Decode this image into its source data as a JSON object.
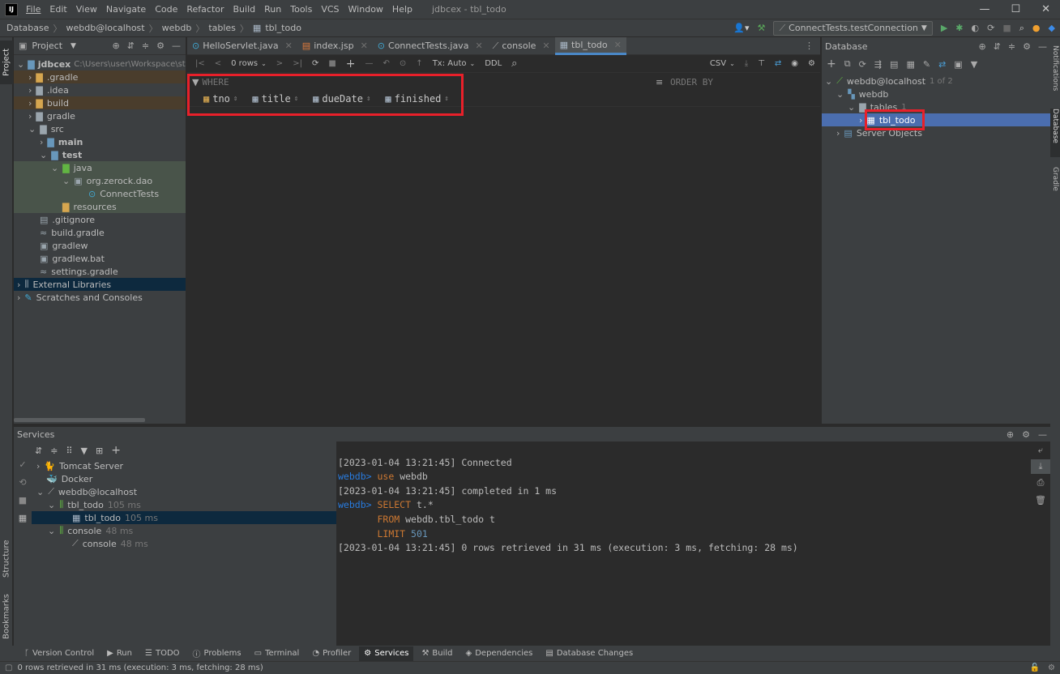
{
  "menu": {
    "items": [
      "File",
      "Edit",
      "View",
      "Navigate",
      "Code",
      "Refactor",
      "Build",
      "Run",
      "Tools",
      "VCS",
      "Window",
      "Help"
    ],
    "title": "jdbcex - tbl_todo"
  },
  "breadcrumb": [
    "Database",
    "webdb@localhost",
    "webdb",
    "tables",
    "tbl_todo"
  ],
  "run_config": "ConnectTests.testConnection",
  "project_panel": {
    "title": "Project",
    "root_name": "jdbcex",
    "root_path": "C:\\Users\\user\\Workspace\\stud",
    "items": [
      ".gradle",
      ".idea",
      "build",
      "gradle",
      "src",
      "main",
      "test",
      "java",
      "org.zerock.dao",
      "ConnectTests",
      "resources",
      ".gitignore",
      "build.gradle",
      "gradlew",
      "gradlew.bat",
      "settings.gradle",
      "External Libraries",
      "Scratches and Consoles"
    ]
  },
  "editor_tabs": [
    "HelloServlet.java",
    "index.jsp",
    "ConnectTests.java",
    "console",
    "tbl_todo"
  ],
  "grid_toolbar": {
    "rows": "0 rows",
    "tx": "Tx: Auto",
    "ddl": "DDL",
    "csv": "CSV"
  },
  "filter": {
    "where": "WHERE",
    "order_by": "ORDER BY"
  },
  "columns": [
    "tno",
    "title",
    "dueDate",
    "finished"
  ],
  "database_panel": {
    "title": "Database",
    "connection": "webdb@localhost",
    "connection_count": "1 of 2",
    "schema": "webdb",
    "tables": "tables",
    "tables_count": "1",
    "table": "tbl_todo",
    "server_objects": "Server Objects"
  },
  "right_strip": [
    "Notifications",
    "Database",
    "Gradle"
  ],
  "left_strip": [
    "Project",
    "Structure",
    "Bookmarks"
  ],
  "services": {
    "title": "Services",
    "tree": {
      "tomcat": "Tomcat Server",
      "docker": "Docker",
      "conn": "webdb@localhost",
      "tbl_group": "tbl_todo",
      "tbl_group_time": "105 ms",
      "tbl_leaf": "tbl_todo",
      "tbl_leaf_time": "105 ms",
      "console_group": "console",
      "console_group_time": "48 ms",
      "console_leaf": "console",
      "console_leaf_time": "48 ms"
    },
    "log": {
      "l1": "[2023-01-04 13:21:45] Connected",
      "l2_prompt": "webdb>",
      "l2_kw": "use",
      "l2_rest": "webdb",
      "l3": "[2023-01-04 13:21:45] completed in 1 ms",
      "l4_prompt": "webdb>",
      "l4_kw": "SELECT",
      "l4_rest": "t.*",
      "l5_kw": "FROM",
      "l5_rest": "webdb.tbl_todo t",
      "l6_kw": "LIMIT",
      "l6_num": "501",
      "l7": "[2023-01-04 13:21:45] 0 rows retrieved in 31 ms (execution: 3 ms, fetching: 28 ms)"
    }
  },
  "bottom_tabs": [
    "Version Control",
    "Run",
    "TODO",
    "Problems",
    "Terminal",
    "Profiler",
    "Services",
    "Build",
    "Dependencies",
    "Database Changes"
  ],
  "status_bar": "0 rows retrieved in 31 ms (execution: 3 ms, fetching: 28 ms)",
  "colors": {
    "accent": "#4b6eaf",
    "highlight_box": "#e8202a",
    "selection": "#0d293e",
    "folder": "#d6a64f"
  }
}
